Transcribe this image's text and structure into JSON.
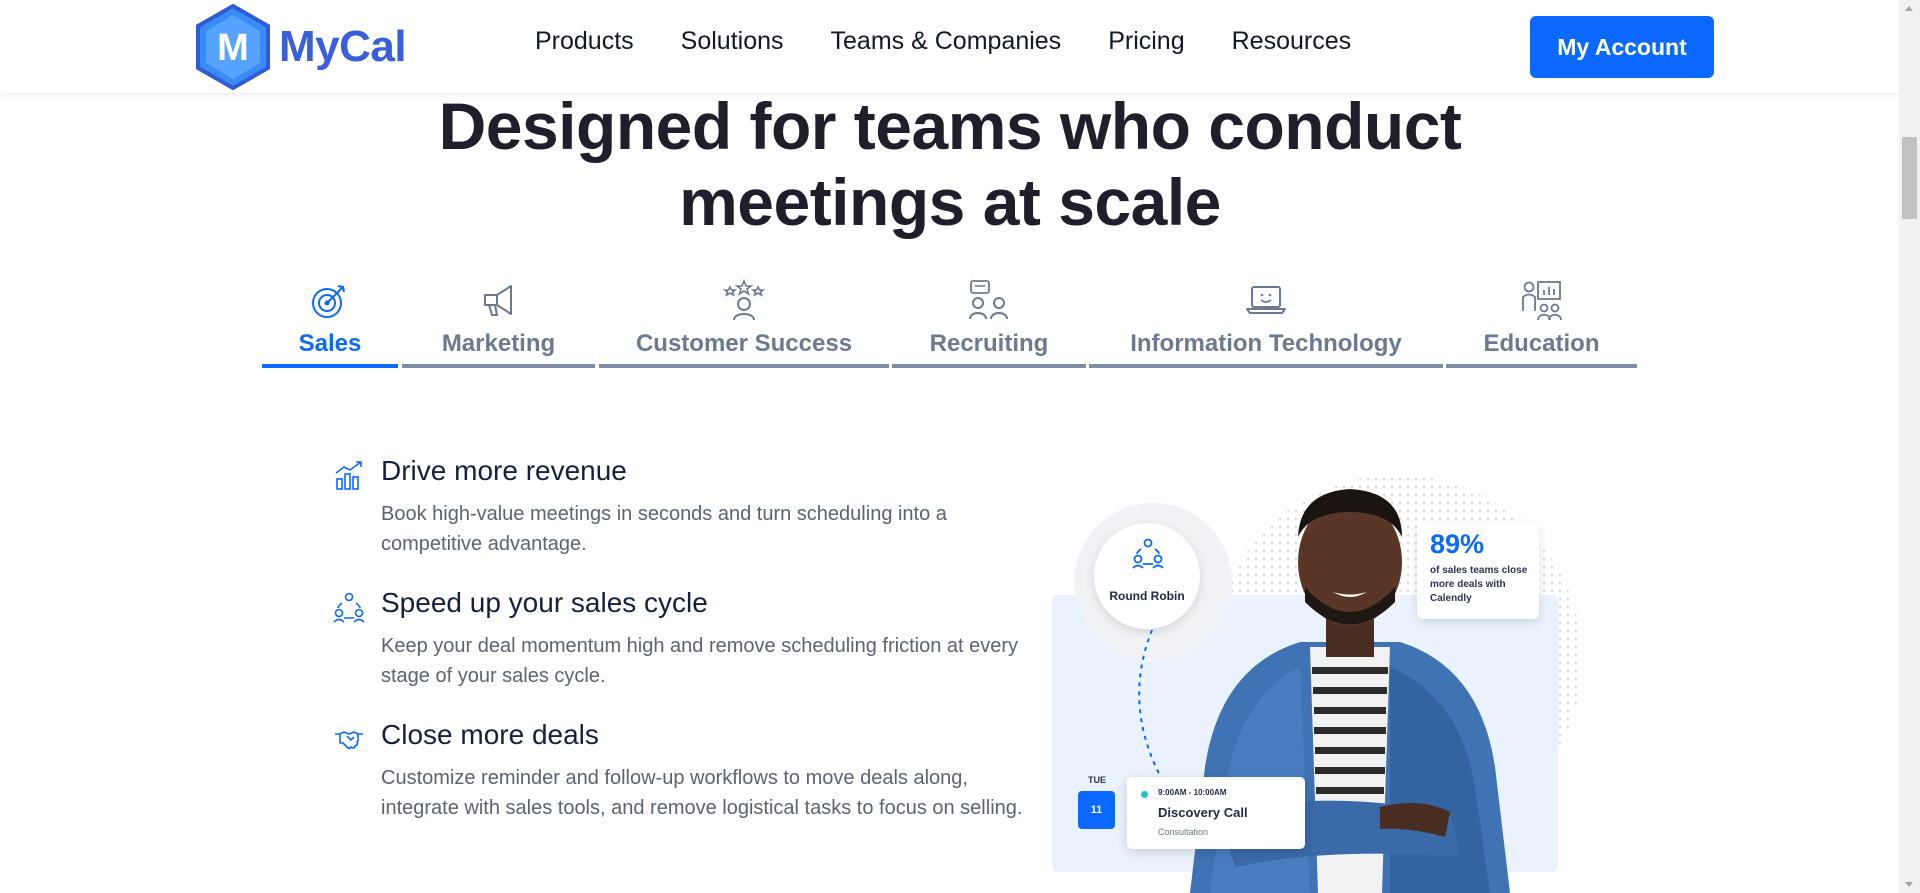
{
  "header": {
    "logo_text": "MyCal",
    "logo_letter": "M",
    "nav": [
      "Products",
      "Solutions",
      "Teams & Companies",
      "Pricing",
      "Resources"
    ],
    "account_button": "My Account"
  },
  "hero": {
    "headline_line1": "Designed for teams who conduct",
    "headline_line2": "meetings at scale"
  },
  "tabs": [
    {
      "label": "Sales",
      "icon": "target-icon",
      "active": true
    },
    {
      "label": "Marketing",
      "icon": "megaphone-icon",
      "active": false
    },
    {
      "label": "Customer Success",
      "icon": "stars-person-icon",
      "active": false
    },
    {
      "label": "Recruiting",
      "icon": "interview-icon",
      "active": false
    },
    {
      "label": "Information Technology",
      "icon": "laptop-icon",
      "active": false
    },
    {
      "label": "Education",
      "icon": "teacher-board-icon",
      "active": false
    }
  ],
  "features": [
    {
      "icon": "bar-chart-growth-icon",
      "title": "Drive more revenue",
      "description": "Book high-value meetings in seconds and turn scheduling into a competitive advantage."
    },
    {
      "icon": "team-cycle-icon",
      "title": "Speed up your sales cycle",
      "description": "Keep your deal momentum high and remove scheduling friction at every stage of your sales cycle."
    },
    {
      "icon": "handshake-icon",
      "title": "Close more deals",
      "description": "Customize reminder and follow-up workflows to move deals along, integrate with sales tools, and remove logistical tasks to focus on selling."
    }
  ],
  "illustration": {
    "round_robin_label": "Round Robin",
    "stat_percent": "89%",
    "stat_text": "of sales teams close more deals with Calendly",
    "day_label": "TUE",
    "date_number": "11",
    "meeting_time": "9:00AM - 10:00AM",
    "meeting_title": "Discovery Call",
    "meeting_subtitle": "Consultation"
  },
  "colors": {
    "brand_blue": "#0b69ff",
    "logo_blue": "#3a5fdc",
    "tab_inactive": "#6b7a90",
    "heading": "#1e1f2b"
  }
}
